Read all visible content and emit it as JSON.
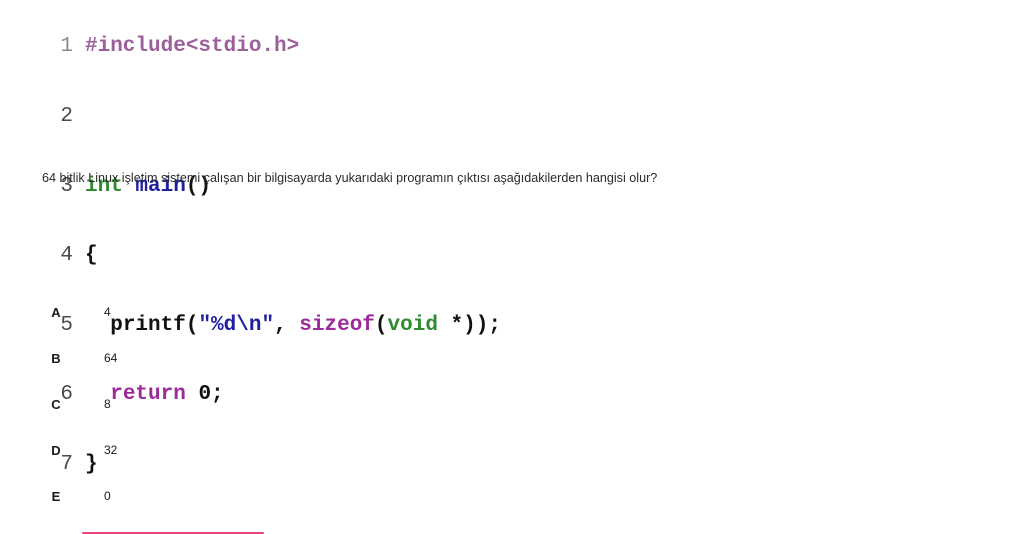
{
  "code": {
    "lines": [
      {
        "num": "1",
        "text": "#include<stdio.h>"
      },
      {
        "num": "2",
        "text": ""
      },
      {
        "num": "3",
        "kw": "int",
        "fn": " main",
        "rest": "()"
      },
      {
        "num": "4",
        "text": "{"
      },
      {
        "num": "5",
        "fn": "printf",
        "p1": "(",
        "str": "\"%d\\n\"",
        "p2": ", ",
        "purple": "sizeof",
        "p3": "(",
        "kw2": "void",
        "p4": " *));"
      },
      {
        "num": "6",
        "purple": "return",
        "rest": " 0;"
      },
      {
        "num": "7",
        "text": "}"
      }
    ]
  },
  "question": {
    "text": "64 bitlik Linux işletim sistemi çalışan bir bilgisayarda yukarıdaki programın çıktısı aşağıdakilerden hangisi olur?"
  },
  "options": [
    {
      "letter": "A",
      "value": "4"
    },
    {
      "letter": "B",
      "value": "64"
    },
    {
      "letter": "C",
      "value": "8"
    },
    {
      "letter": "D",
      "value": "32"
    },
    {
      "letter": "E",
      "value": "0"
    }
  ],
  "colors": {
    "accent": "#e8457a",
    "keyword_green": "#2e8b2e",
    "function_blue": "#1f1fa0",
    "keyword_purple": "#9b2a9b"
  }
}
